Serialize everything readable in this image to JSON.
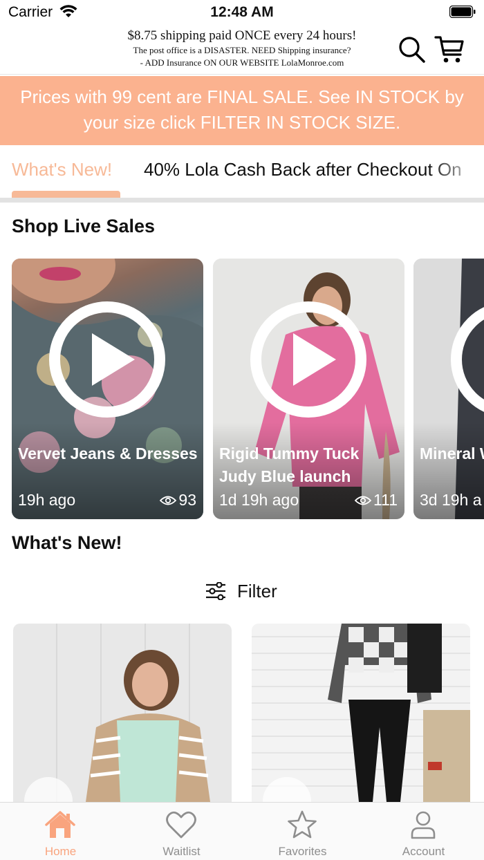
{
  "status_bar": {
    "carrier": "Carrier",
    "time": "12:48 AM"
  },
  "header": {
    "notice_line1": "$8.75 shipping paid ONCE every 24 hours!",
    "notice_line2": "The post office is a DISASTER. NEED Shipping insurance?",
    "notice_line3": "- ADD Insurance ON OUR WEBSITE LolaMonroe.com",
    "icons": [
      "search-icon",
      "cart-icon"
    ]
  },
  "banner": {
    "text": "Prices with 99 cent are FINAL SALE. See IN STOCK by your size click FILTER IN STOCK SIZE.",
    "background": "#fbb28f"
  },
  "tabs": [
    {
      "label": "What's New!",
      "active": true
    },
    {
      "label": "40% Lola Cash Back after Checkout On",
      "active": false
    }
  ],
  "live_sales": {
    "title": "Shop Live Sales",
    "cards": [
      {
        "title": "Vervet Jeans & Dresses",
        "time": "19h ago",
        "views": "93"
      },
      {
        "title": "Rigid Tummy Tuck Judy Blue launch",
        "time": "1d 19h ago",
        "views": "111"
      },
      {
        "title": "Mineral W Control j",
        "time": "3d 19h a",
        "views": ""
      }
    ]
  },
  "whats_new": {
    "title": "What's New!",
    "filter_label": "Filter"
  },
  "tabbar": [
    {
      "label": "Home",
      "icon": "home-icon",
      "active": true
    },
    {
      "label": "Waitlist",
      "icon": "heart-icon",
      "active": false
    },
    {
      "label": "Favorites",
      "icon": "star-icon",
      "active": false
    },
    {
      "label": "Account",
      "icon": "person-icon",
      "active": false
    }
  ],
  "colors": {
    "accent": "#f7b997",
    "banner": "#fbb28f",
    "tab_active": "#f9a47e",
    "tab_inactive": "#8e8e8e"
  }
}
